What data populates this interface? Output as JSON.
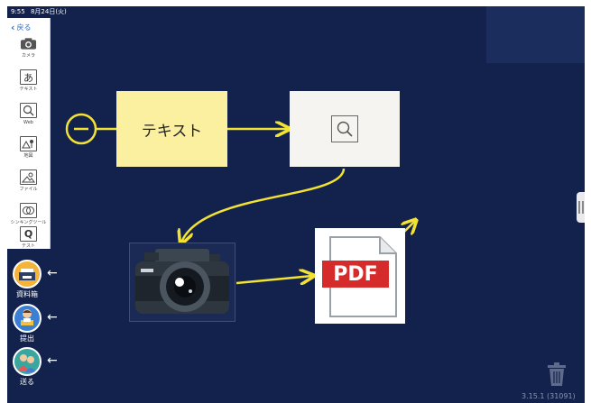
{
  "status_bar": {
    "time": "9:55",
    "date": "8月24日(火)"
  },
  "toolbar": {
    "back_label": "戻る",
    "tools": [
      {
        "label": "カメラ",
        "icon": "camera-icon"
      },
      {
        "label": "テキスト",
        "icon": "text-icon",
        "glyph": "あ"
      },
      {
        "label": "Web",
        "icon": "web-search-icon"
      },
      {
        "label": "地図",
        "icon": "map-icon"
      },
      {
        "label": "ファイル",
        "icon": "file-icon"
      },
      {
        "label": "シンキングツール",
        "icon": "thinking-tool-icon"
      },
      {
        "label": "テスト",
        "icon": "test-icon",
        "glyph": "Q"
      }
    ]
  },
  "side_buttons": [
    {
      "label": "資料箱",
      "icon": "material-box-icon"
    },
    {
      "label": "提出",
      "icon": "submit-icon"
    },
    {
      "label": "送る",
      "icon": "send-icon"
    }
  ],
  "canvas": {
    "text_card": "テキスト",
    "pdf_card_text": "PDF"
  },
  "version": "3.15.1 (31091)",
  "colors": {
    "background": "#13224d",
    "connector": "#f2e233",
    "text_card": "#fbf0a0",
    "pdf_red": "#d62b2b",
    "toolbar_accent": "#2a6fd8"
  }
}
